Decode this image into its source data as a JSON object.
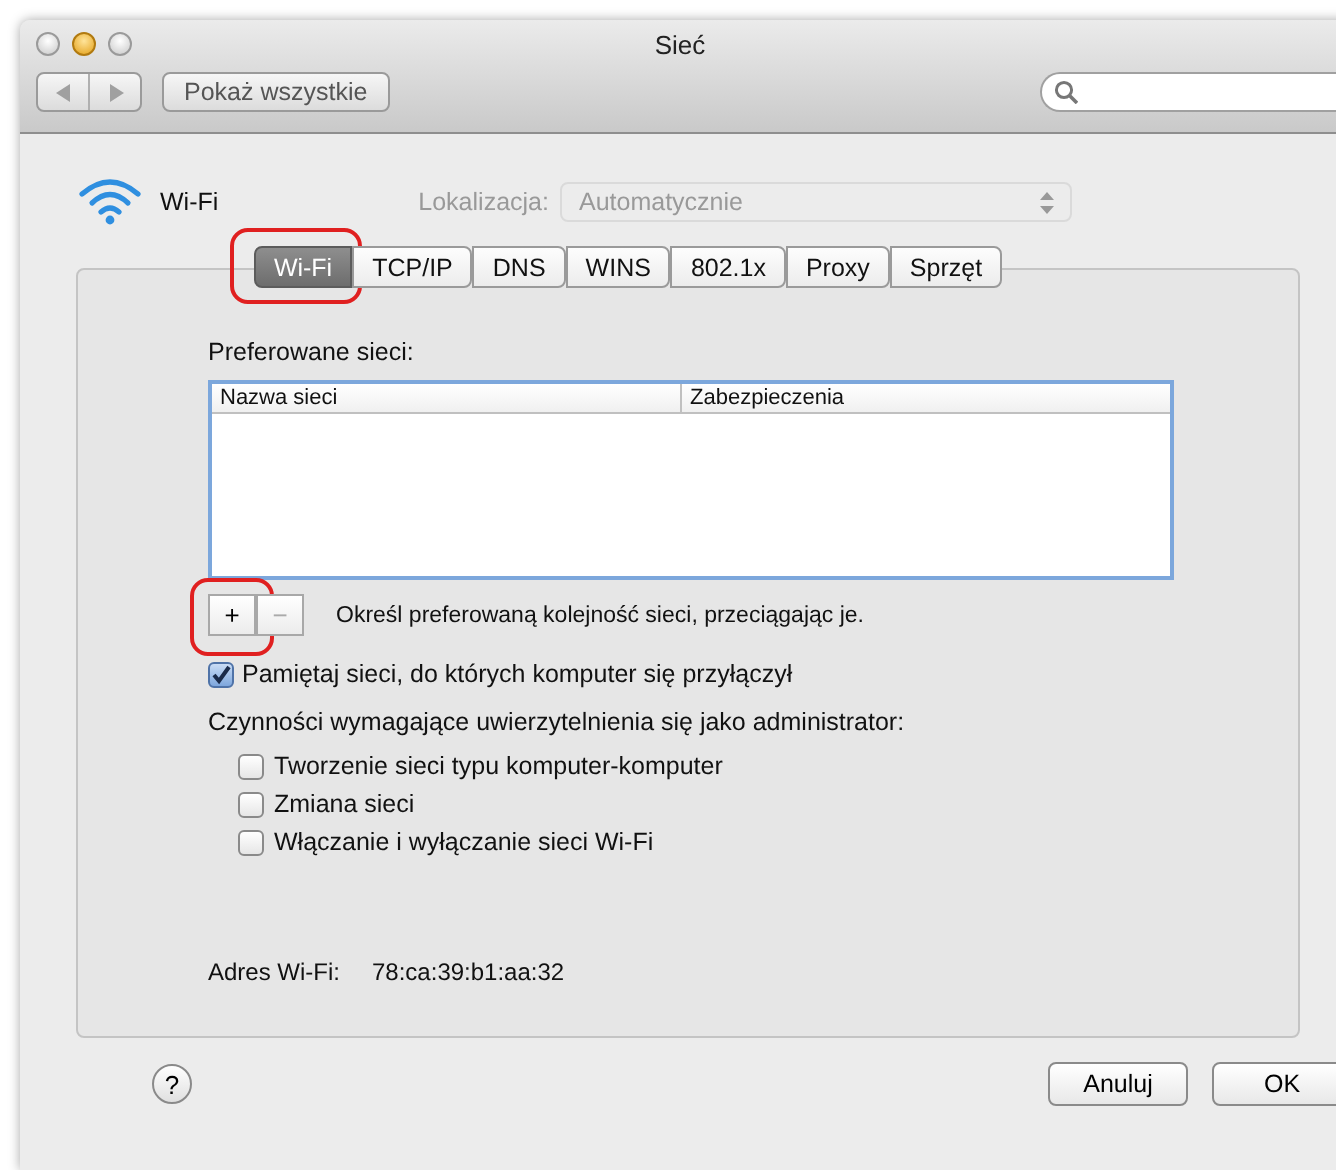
{
  "window": {
    "title": "Sieć"
  },
  "toolbar": {
    "show_all": "Pokaż wszystkie"
  },
  "header": {
    "service": "Wi-Fi",
    "location_label": "Lokalizacja:",
    "location_value": "Automatycznie"
  },
  "tabs": [
    {
      "label": "Wi-Fi",
      "selected": true,
      "highlighted": true
    },
    {
      "label": "TCP/IP",
      "selected": false,
      "highlighted": false
    },
    {
      "label": "DNS",
      "selected": false,
      "highlighted": false
    },
    {
      "label": "WINS",
      "selected": false,
      "highlighted": false
    },
    {
      "label": "802.1x",
      "selected": false,
      "highlighted": false
    },
    {
      "label": "Proxy",
      "selected": false,
      "highlighted": false
    },
    {
      "label": "Sprzęt",
      "selected": false,
      "highlighted": false
    }
  ],
  "preferred": {
    "label": "Preferowane sieci:",
    "columns": [
      "Nazwa sieci",
      "Zabezpieczenia"
    ],
    "add_button": {
      "label": "+",
      "highlighted": true
    },
    "remove_button": {
      "label": "−"
    },
    "hint": "Określ preferowaną kolejność sieci, przeciągając je."
  },
  "remember": {
    "label": "Pamiętaj sieci, do których komputer się przyłączył",
    "checked": true
  },
  "admin": {
    "label": "Czynności wymagające uwierzytelnienia się jako administrator:",
    "options": [
      {
        "label": "Tworzenie sieci typu komputer-komputer",
        "checked": false
      },
      {
        "label": "Zmiana sieci",
        "checked": false
      },
      {
        "label": "Włączanie i wyłączanie sieci Wi-Fi",
        "checked": false
      }
    ]
  },
  "address": {
    "label": "Adres Wi-Fi:",
    "value": "78:ca:39:b1:aa:32"
  },
  "help_button": "?",
  "buttons": [
    {
      "label": "Anuluj"
    },
    {
      "label": "OK"
    }
  ]
}
